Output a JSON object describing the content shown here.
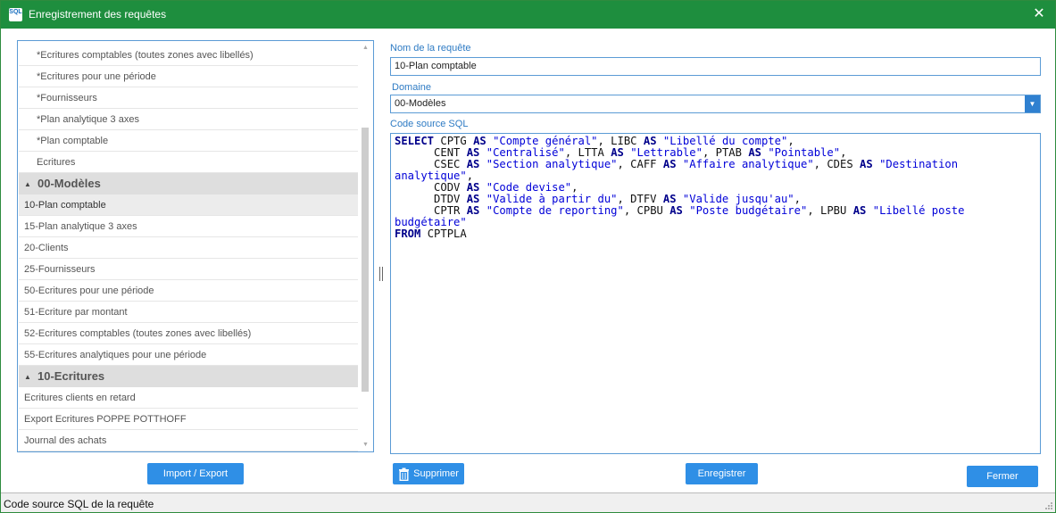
{
  "window": {
    "title": "Enregistrement des requêtes",
    "icon_text": "SQL",
    "close_glyph": "✕"
  },
  "list": {
    "items": [
      {
        "type": "item",
        "label": "*Ecritures comptables (toutes zones avec libellés)"
      },
      {
        "type": "item",
        "label": "*Ecritures pour une période"
      },
      {
        "type": "item",
        "label": "*Fournisseurs"
      },
      {
        "type": "item",
        "label": "*Plan analytique 3 axes"
      },
      {
        "type": "item",
        "label": "*Plan comptable"
      },
      {
        "type": "item",
        "label": "Ecritures"
      },
      {
        "type": "group",
        "label": "00-Modèles"
      },
      {
        "type": "item",
        "label": "10-Plan comptable",
        "selected": true,
        "sub": true
      },
      {
        "type": "item",
        "label": "15-Plan analytique 3 axes"
      },
      {
        "type": "item",
        "label": "20-Clients"
      },
      {
        "type": "item",
        "label": "25-Fournisseurs"
      },
      {
        "type": "item",
        "label": "50-Ecritures pour une période"
      },
      {
        "type": "item",
        "label": "51-Ecriture par montant"
      },
      {
        "type": "item",
        "label": "52-Ecritures comptables (toutes zones avec libellés)"
      },
      {
        "type": "item",
        "label": "55-Ecritures analytiques pour une période"
      },
      {
        "type": "group",
        "label": "10-Ecritures"
      },
      {
        "type": "item",
        "label": "Ecritures clients en retard"
      },
      {
        "type": "item",
        "label": "Export Ecritures POPPE POTTHOFF"
      },
      {
        "type": "item",
        "label": "Journal des achats"
      }
    ]
  },
  "form": {
    "name_label": "Nom de la requête",
    "name_value": "10-Plan comptable",
    "domain_label": "Domaine",
    "domain_value": "00-Modèles",
    "sql_label": "Code source SQL",
    "sql_tokens": [
      [
        [
          "kw",
          "SELECT"
        ],
        [
          "t",
          " CPTG "
        ],
        [
          "kw",
          "AS"
        ],
        [
          "t",
          " "
        ],
        [
          "str",
          "\"Compte général\""
        ],
        [
          "t",
          ", LIBC "
        ],
        [
          "kw",
          "AS"
        ],
        [
          "t",
          " "
        ],
        [
          "str",
          "\"Libellé du compte\""
        ],
        [
          "t",
          ","
        ]
      ],
      [
        [
          "t",
          "      CENT "
        ],
        [
          "kw",
          "AS"
        ],
        [
          "t",
          " "
        ],
        [
          "str",
          "\"Centralisé\""
        ],
        [
          "t",
          ", LTTA "
        ],
        [
          "kw",
          "AS"
        ],
        [
          "t",
          " "
        ],
        [
          "str",
          "\"Lettrable\""
        ],
        [
          "t",
          ", PTAB "
        ],
        [
          "kw",
          "AS"
        ],
        [
          "t",
          " "
        ],
        [
          "str",
          "\"Pointable\""
        ],
        [
          "t",
          ","
        ]
      ],
      [
        [
          "t",
          "      CSEC "
        ],
        [
          "kw",
          "AS"
        ],
        [
          "t",
          " "
        ],
        [
          "str",
          "\"Section analytique\""
        ],
        [
          "t",
          ", CAFF "
        ],
        [
          "kw",
          "AS"
        ],
        [
          "t",
          " "
        ],
        [
          "str",
          "\"Affaire analytique\""
        ],
        [
          "t",
          ", CDES "
        ],
        [
          "kw",
          "AS"
        ],
        [
          "t",
          " "
        ],
        [
          "str",
          "\"Destination analytique\""
        ],
        [
          "t",
          ","
        ]
      ],
      [
        [
          "t",
          "      CODV "
        ],
        [
          "kw",
          "AS"
        ],
        [
          "t",
          " "
        ],
        [
          "str",
          "\"Code devise\""
        ],
        [
          "t",
          ","
        ]
      ],
      [
        [
          "t",
          "      DTDV "
        ],
        [
          "kw",
          "AS"
        ],
        [
          "t",
          " "
        ],
        [
          "str",
          "\"Valide à partir du\""
        ],
        [
          "t",
          ", DTFV "
        ],
        [
          "kw",
          "AS"
        ],
        [
          "t",
          " "
        ],
        [
          "str",
          "\"Valide jusqu'au\""
        ],
        [
          "t",
          ","
        ]
      ],
      [
        [
          "t",
          "      CPTR "
        ],
        [
          "kw",
          "AS"
        ],
        [
          "t",
          " "
        ],
        [
          "str",
          "\"Compte de reporting\""
        ],
        [
          "t",
          ", CPBU "
        ],
        [
          "kw",
          "AS"
        ],
        [
          "t",
          " "
        ],
        [
          "str",
          "\"Poste budgétaire\""
        ],
        [
          "t",
          ", LPBU "
        ],
        [
          "kw",
          "AS"
        ],
        [
          "t",
          " "
        ],
        [
          "str",
          "\"Libellé poste budgétaire\""
        ]
      ],
      [
        [
          "kw",
          "FROM"
        ],
        [
          "t",
          " CPTPLA"
        ]
      ]
    ]
  },
  "buttons": {
    "import_export": "Import / Export",
    "delete": "Supprimer",
    "save": "Enregistrer",
    "close": "Fermer"
  },
  "status": {
    "text": "Code source SQL de la requête"
  },
  "colors": {
    "titlebar": "#1e8e3e",
    "accent": "#2f8fe6",
    "keyword": "#00008b",
    "string": "#0000d8"
  }
}
